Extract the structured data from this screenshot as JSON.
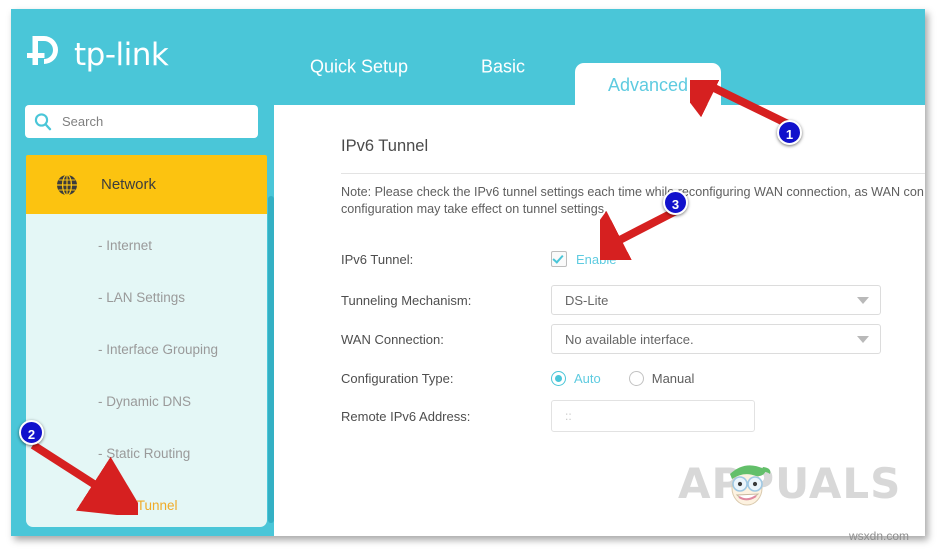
{
  "brand": {
    "name": "tp-link",
    "logo_icon": "tp-link-logo-icon"
  },
  "colors": {
    "teal": "#4ac6d8",
    "teal_text": "#5ecbe0",
    "yellow": "#fcc310",
    "submenu_bg": "#e4f7f6",
    "active_item": "#f0ab28",
    "annotation_red": "#d62020",
    "badge_blue": "#1111cc"
  },
  "sidebar": {
    "search": {
      "placeholder": "Search",
      "value": "",
      "icon": "search-icon"
    },
    "network": {
      "label": "Network",
      "icon": "globe-icon"
    },
    "items": [
      {
        "label": "- Internet",
        "active": false
      },
      {
        "label": "- LAN Settings",
        "active": false
      },
      {
        "label": "- Interface Grouping",
        "active": false
      },
      {
        "label": "- Dynamic DNS",
        "active": false
      },
      {
        "label": "- Static Routing",
        "active": false
      },
      {
        "label": "- IPv6 Tunnel",
        "active": true
      }
    ]
  },
  "tabs": [
    {
      "label": "Quick Setup",
      "selected": false
    },
    {
      "label": "Basic",
      "selected": false
    },
    {
      "label": "Advanced",
      "selected": true
    }
  ],
  "main": {
    "page_title": "IPv6 Tunnel",
    "note_line1": "Note: Please check the IPv6 tunnel settings each time while reconfiguring WAN connection, as WAN con",
    "note_line2": "configuration may take effect on tunnel settings.",
    "fields": {
      "ipv6_tunnel": {
        "label": "IPv6 Tunnel:",
        "checkbox_label": "Enable",
        "checked": true
      },
      "tunneling_mechanism": {
        "label": "Tunneling Mechanism:",
        "value": "DS-Lite"
      },
      "wan_connection": {
        "label": "WAN Connection:",
        "value": "No available interface."
      },
      "configuration_type": {
        "label": "Configuration Type:",
        "options": [
          {
            "label": "Auto",
            "selected": true
          },
          {
            "label": "Manual",
            "selected": false
          }
        ]
      },
      "remote_ipv6_address": {
        "label": "Remote IPv6 Address:",
        "placeholder": "::",
        "value": ""
      }
    }
  },
  "watermark": {
    "text": "APPUALS",
    "mascot_icon": "appuals-mascot-icon",
    "site": "wsxdn.com"
  },
  "annotations": [
    {
      "badge": "1",
      "target": "advanced-tab"
    },
    {
      "badge": "2",
      "target": "ipv6-tunnel-menu-item"
    },
    {
      "badge": "3",
      "target": "enable-checkbox"
    }
  ]
}
